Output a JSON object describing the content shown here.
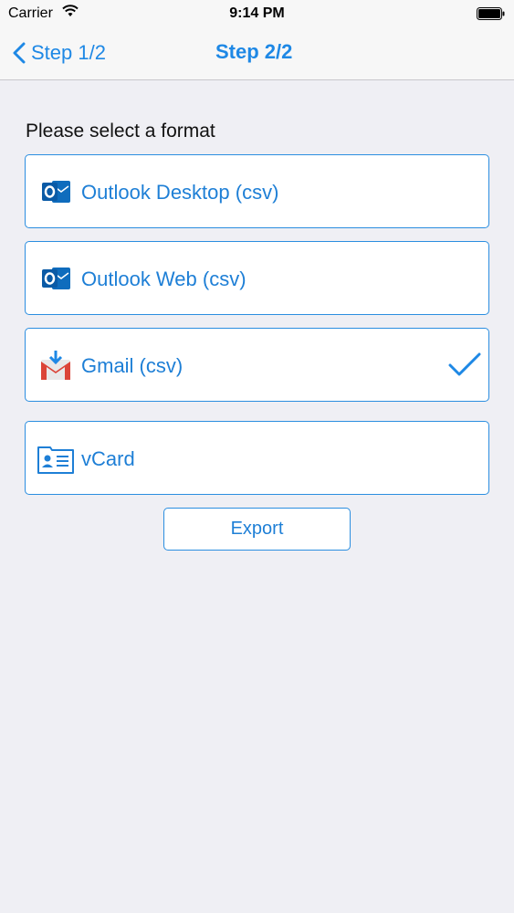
{
  "status_bar": {
    "carrier": "Carrier",
    "time": "9:14 PM"
  },
  "nav": {
    "back_label": "Step 1/2",
    "title": "Step 2/2"
  },
  "main": {
    "prompt": "Please select a format",
    "options": [
      {
        "label": "Outlook Desktop (csv)",
        "icon": "outlook-icon",
        "selected": false
      },
      {
        "label": "Outlook Web (csv)",
        "icon": "outlook-icon",
        "selected": false
      },
      {
        "label": "Gmail (csv)",
        "icon": "gmail-icon",
        "selected": true
      },
      {
        "label": "vCard",
        "icon": "vcard-icon",
        "selected": false
      }
    ],
    "export_label": "Export"
  },
  "colors": {
    "accent": "#1e88e5",
    "border": "#2b8ee0",
    "background": "#efeff4",
    "outlook": "#0f6cbd",
    "gmail_red": "#db4437"
  }
}
